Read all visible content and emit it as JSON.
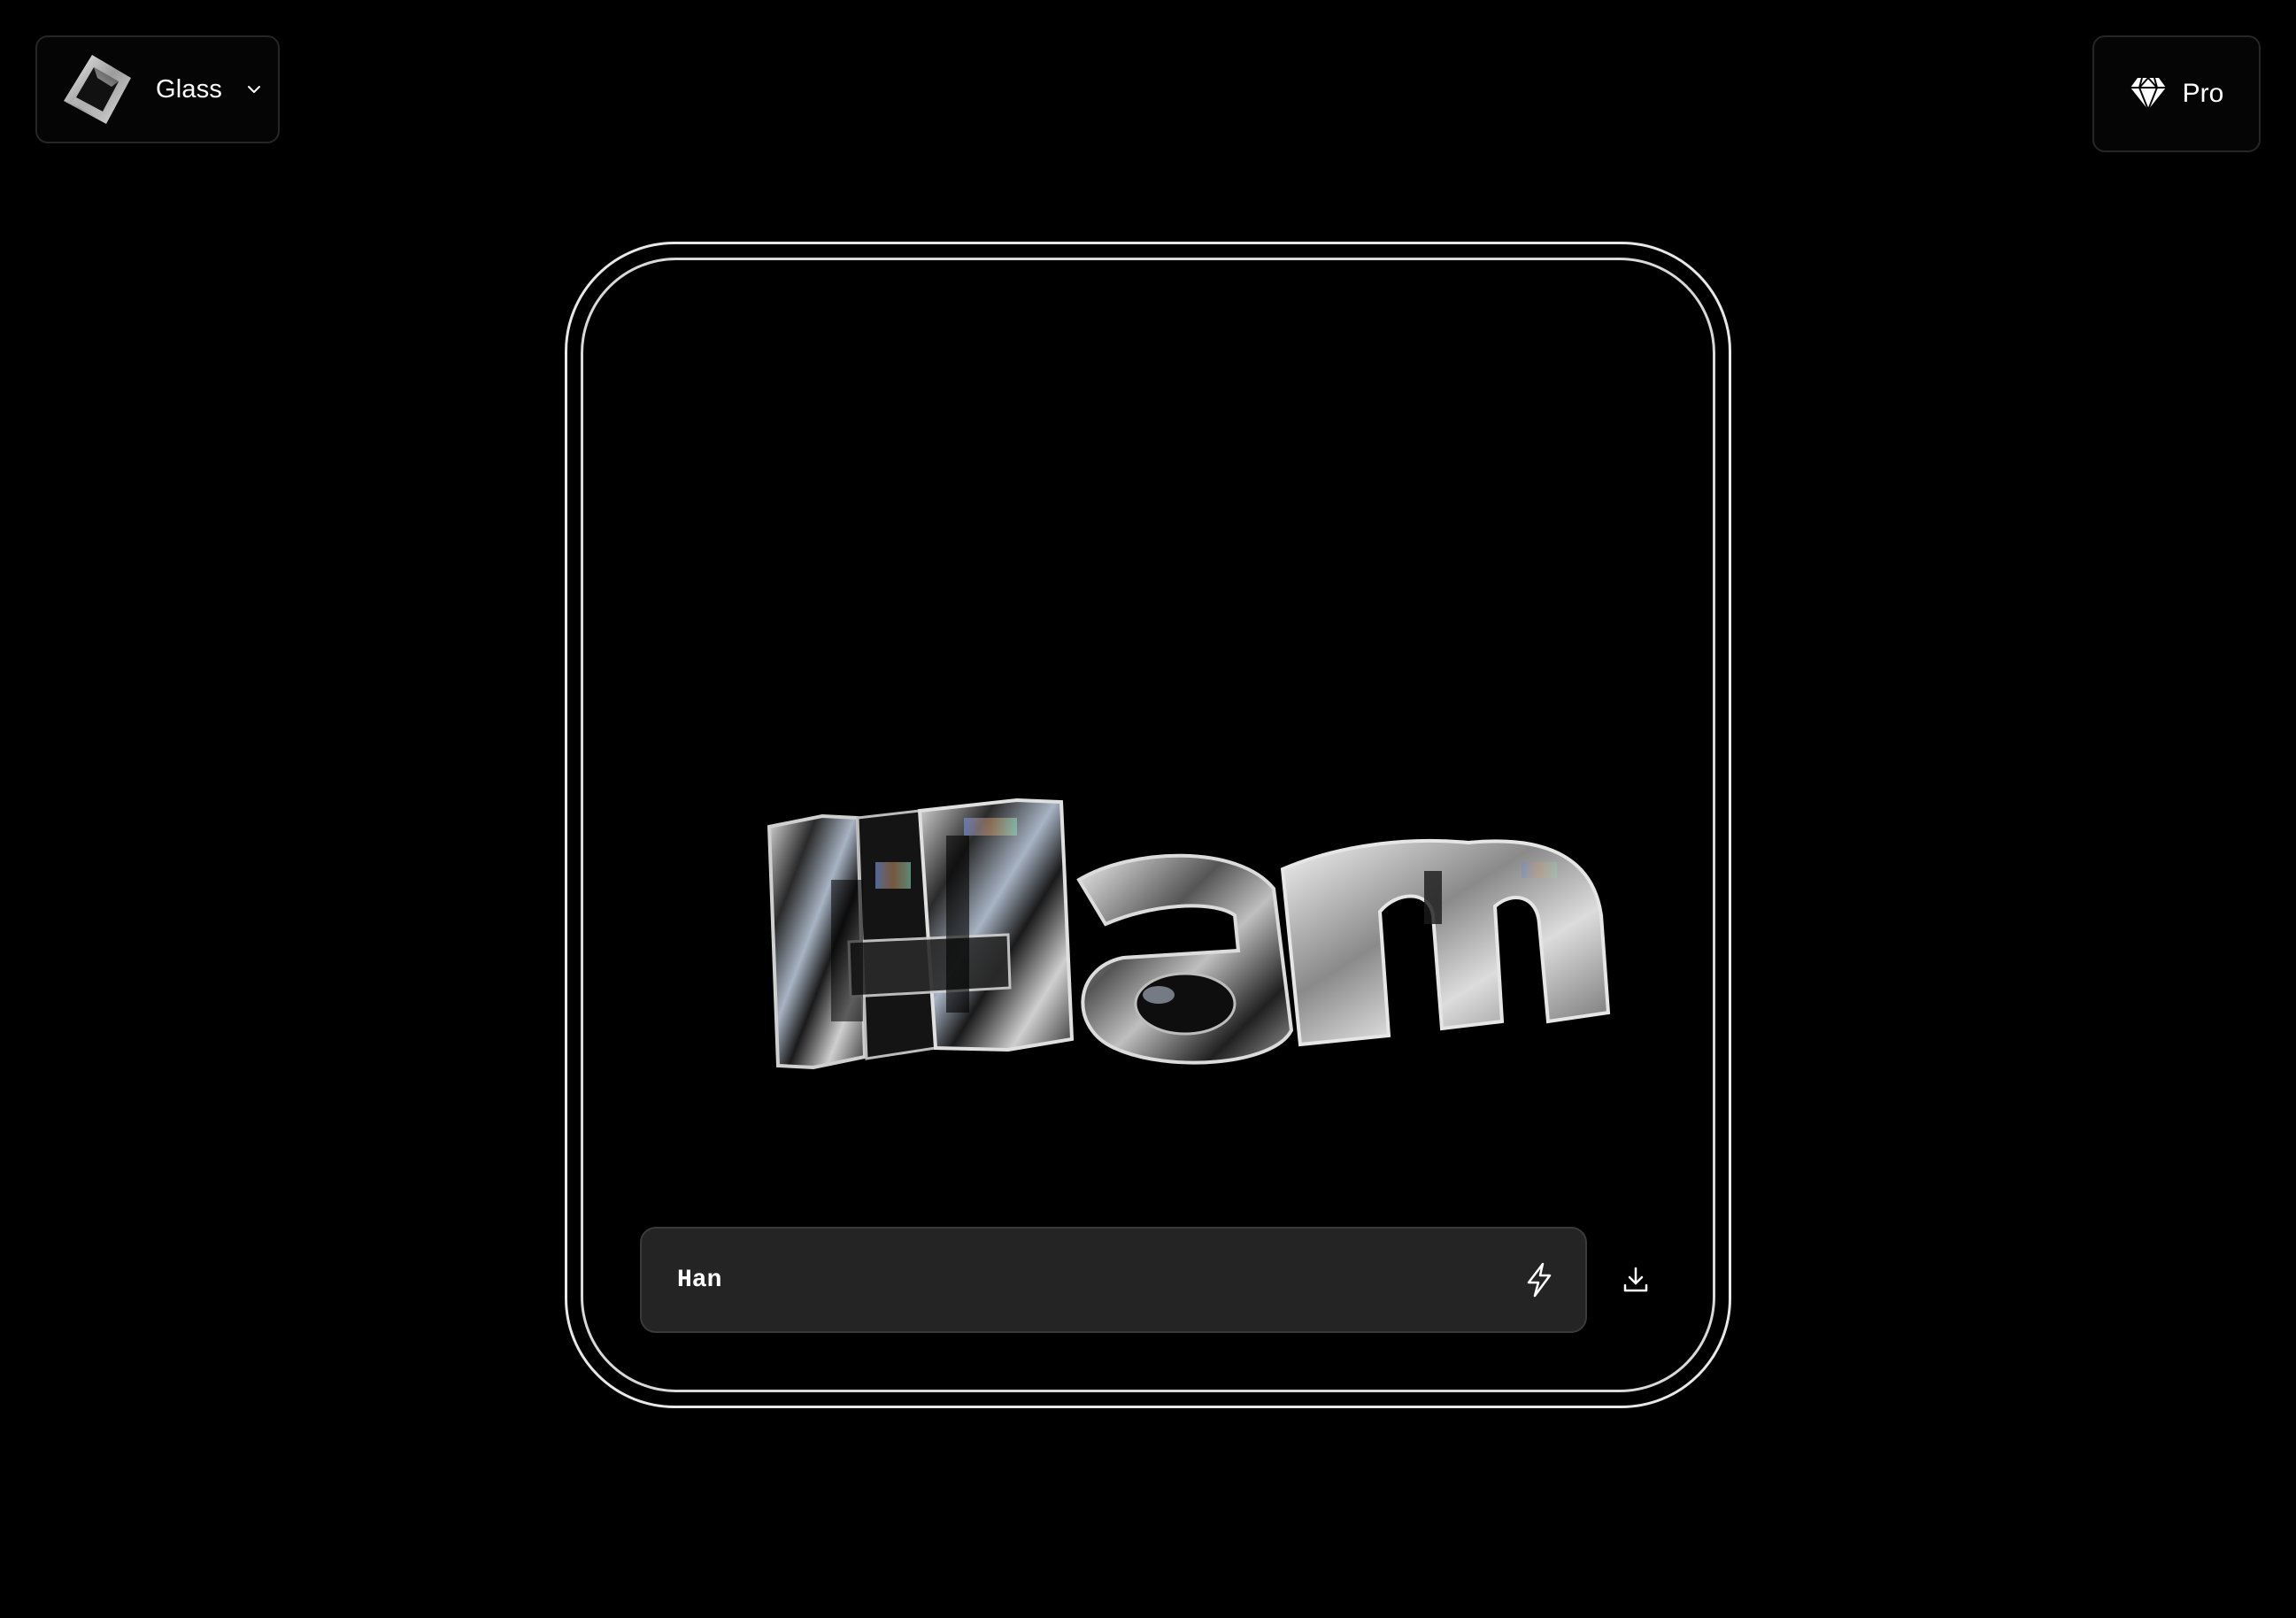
{
  "style_selector": {
    "label": "Glass",
    "icon": "glass-cube-icon"
  },
  "pro_button": {
    "label": "Pro",
    "icon": "diamond-icon"
  },
  "render": {
    "text": "Han",
    "material": "glass"
  },
  "input": {
    "value": "Han",
    "generate_icon": "lightning-bolt-icon",
    "download_icon": "download-icon"
  },
  "colors": {
    "background": "#000000",
    "card_border": "#e8e8e8",
    "input_background": "#242424",
    "text": "#ffffff"
  }
}
